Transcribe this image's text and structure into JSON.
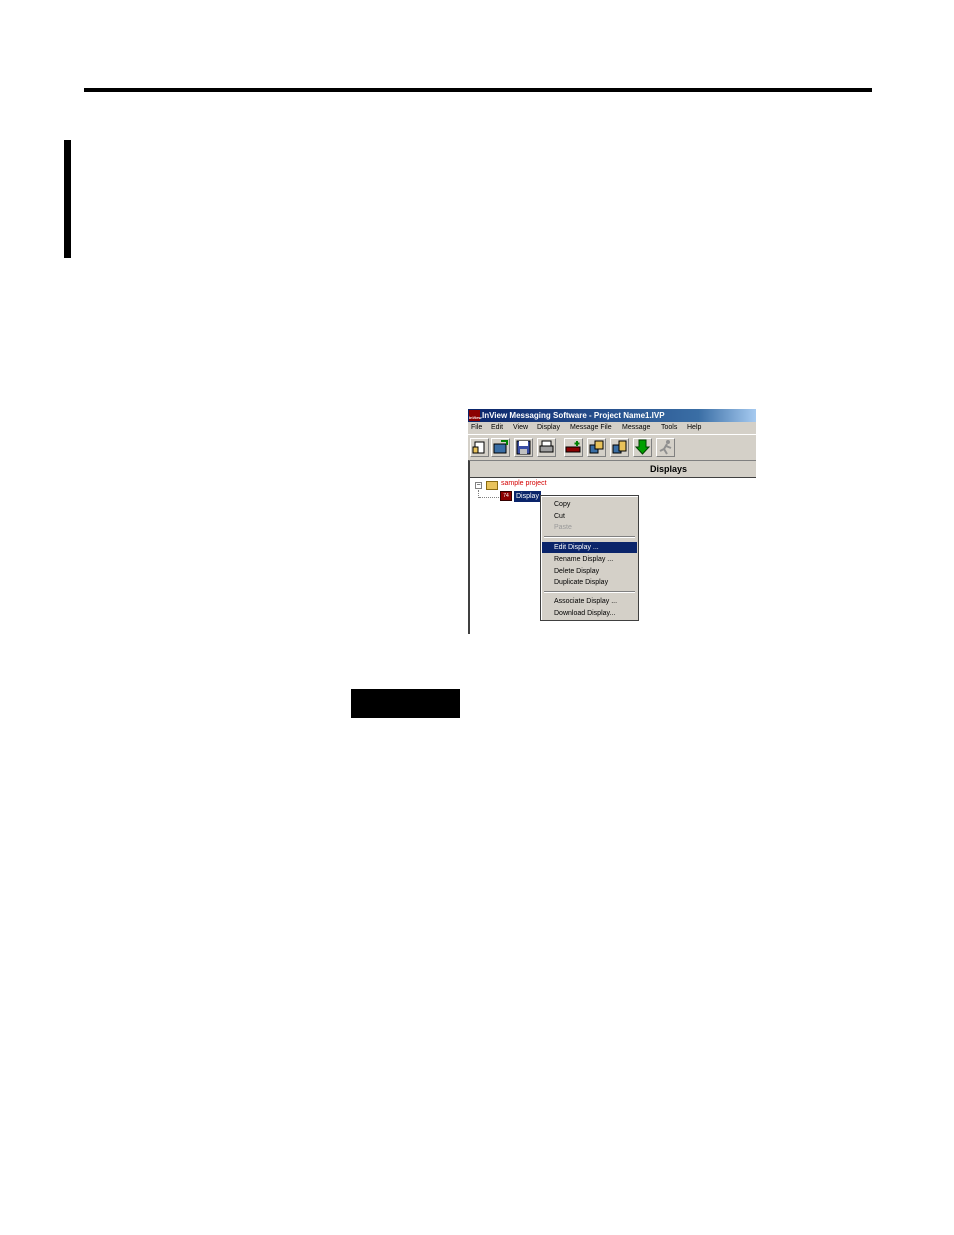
{
  "app": {
    "icon_label": "InView",
    "title": "InView Messaging Software - Project Name1.IVP"
  },
  "menubar": {
    "items": [
      "File",
      "Edit",
      "View",
      "Display",
      "Message File",
      "Message",
      "Tools",
      "Help"
    ]
  },
  "toolbar": {
    "buttons": [
      "new-project-icon",
      "open-project-icon",
      "save-icon",
      "print-icon",
      "add-display-icon",
      "copy-display-icon",
      "associate-icon",
      "download-icon",
      "run-icon"
    ]
  },
  "panel": {
    "header": "Displays"
  },
  "tree": {
    "root_label": "sample project",
    "expander": "−",
    "child_label": "Display",
    "child_icon_text": "74"
  },
  "context_menu": {
    "items": [
      {
        "label": "Copy",
        "state": "normal"
      },
      {
        "label": "Cut",
        "state": "normal"
      },
      {
        "label": "Paste",
        "state": "disabled"
      },
      {
        "label": "Edit Display ...",
        "state": "highlighted"
      },
      {
        "label": "Rename Display ...",
        "state": "normal"
      },
      {
        "label": "Delete Display",
        "state": "normal"
      },
      {
        "label": "Duplicate Display",
        "state": "normal"
      },
      {
        "label": "Associate Display ...",
        "state": "normal"
      },
      {
        "label": "Download Display...",
        "state": "normal"
      }
    ]
  },
  "colors": {
    "titlebar": "#0a246a",
    "highlight": "#0a246a",
    "chrome": "#d4d0c8",
    "root_label": "#d40000"
  }
}
